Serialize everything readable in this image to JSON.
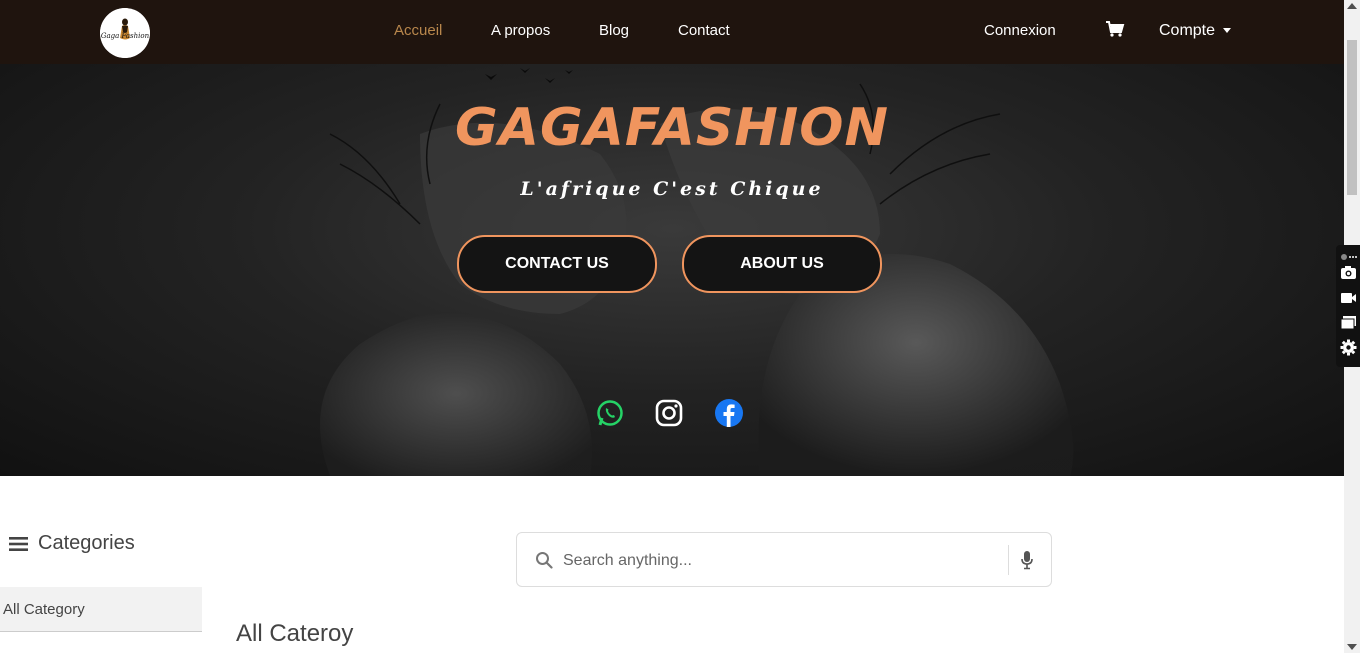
{
  "nav": {
    "logo_text": "Gaga Fashion",
    "links": [
      "Accueil",
      "A propos",
      "Blog",
      "Contact"
    ],
    "login": "Connexion",
    "account": "Compte",
    "active_color": "#b8874c"
  },
  "hero": {
    "title": "GAGAFASHION",
    "subtitle": "L'afrique C'est Chique",
    "contact_btn": "CONTACT US",
    "about_btn": "ABOUT US",
    "accent_color": "#f0955e",
    "socials": [
      "whatsapp-icon",
      "instagram-icon",
      "facebook-icon"
    ]
  },
  "sidebar": {
    "heading": "Categories",
    "items": [
      "All Category"
    ]
  },
  "search": {
    "placeholder": "Search anything..."
  },
  "main": {
    "section_title": "All Cateroy"
  }
}
